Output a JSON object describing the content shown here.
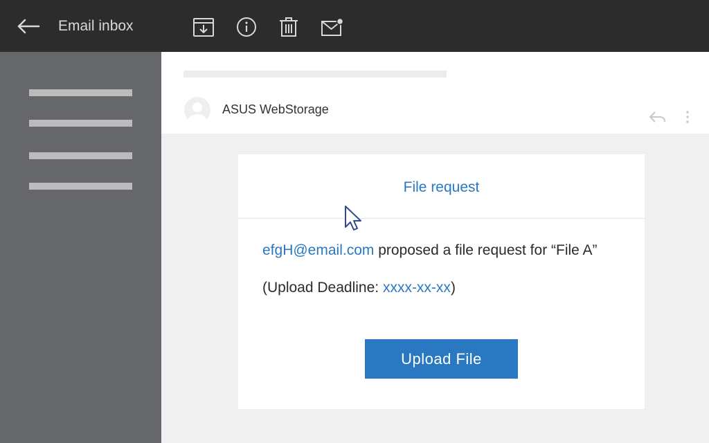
{
  "topbar": {
    "title": "Email inbox",
    "icons": [
      "back-arrow-icon",
      "archive-icon",
      "info-icon",
      "trash-icon",
      "mark-unread-icon"
    ]
  },
  "sidebar": {
    "item_count_note": "four placeholder menu lines"
  },
  "message": {
    "sender": "ASUS WebStorage"
  },
  "card": {
    "title": "File request",
    "requester_email": "efgH@email.com",
    "request_text": " proposed a file request for “File A”",
    "deadline_prefix": "(Upload Deadline: ",
    "deadline_value": "xxxx-xx-xx",
    "deadline_suffix": ")",
    "upload_button_label": "Upload File"
  },
  "colors": {
    "topbar": "#2c2c2c",
    "sidebar": "#66676a",
    "accent": "#2a78c1",
    "background": "#f0f0f0"
  }
}
